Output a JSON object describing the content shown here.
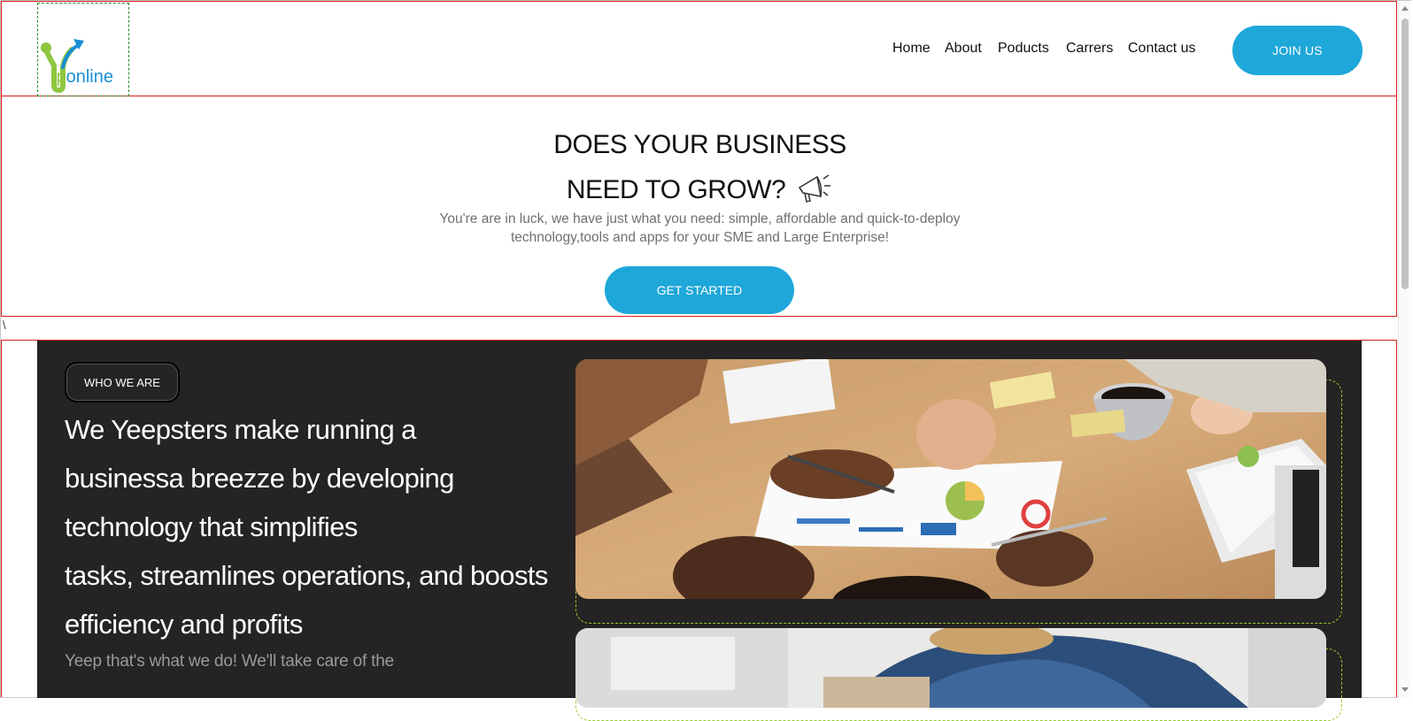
{
  "brand": {
    "logo_text_ip": "ip",
    "logo_text_online": "online",
    "colors": {
      "green": "#8dc63f",
      "blue": "#1a8fd6",
      "accent": "#1ea7d9",
      "dark": "#252323"
    }
  },
  "nav": {
    "items": [
      {
        "label": "Home"
      },
      {
        "label": "About"
      },
      {
        "label": "Poducts"
      },
      {
        "label": "Carrers"
      },
      {
        "label": "Contact us"
      }
    ],
    "join_label": "JOIN US"
  },
  "hero": {
    "title_line1": "DOES YOUR BUSINESS",
    "title_line2": "NEED TO GROW?",
    "icon": "megaphone-icon",
    "sub_line1": "You're are in luck, we have just what you need: simple, affordable and quick-to-deploy",
    "sub_line2": "technology,tools and apps for your SME and Large Enterprise!",
    "cta_label": "GET STARTED"
  },
  "stray_char": "\\",
  "about": {
    "pill_label": "WHO WE ARE",
    "lines": [
      "We Yeepsters make running a",
      "businessa breezze by developing",
      "technology that simplifies",
      "tasks, streamlines operations, and boosts",
      "efficiency and profits"
    ],
    "more": "Yeep that's what we do! We'll take care of the",
    "image1": "team-meeting-charts-image",
    "image2": "office-worker-image"
  }
}
